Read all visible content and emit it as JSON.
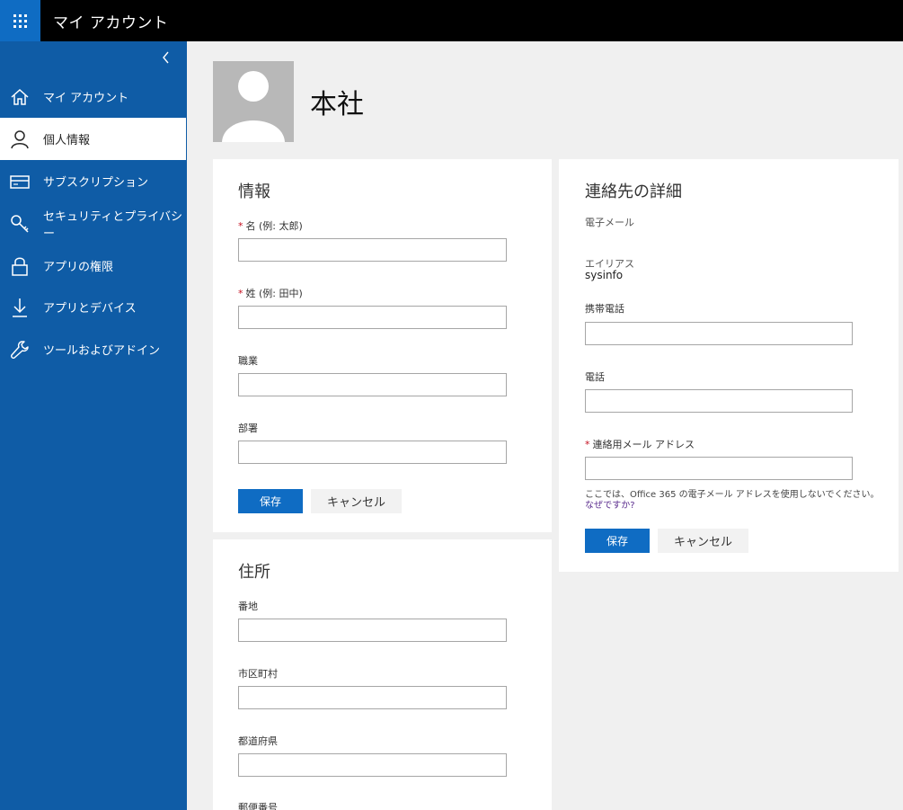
{
  "app": {
    "title": "マイ アカウント"
  },
  "sidebar": {
    "items": [
      {
        "label": "マイ アカウント",
        "icon": "home-icon",
        "active": false
      },
      {
        "label": "個人情報",
        "icon": "person-icon",
        "active": true
      },
      {
        "label": "サブスクリプション",
        "icon": "card-icon",
        "active": false
      },
      {
        "label": "セキュリティとプライバシー",
        "icon": "key-icon",
        "active": false
      },
      {
        "label": "アプリの権限",
        "icon": "lock-icon",
        "active": false
      },
      {
        "label": "アプリとデバイス",
        "icon": "download-icon",
        "active": false
      },
      {
        "label": "ツールおよびアドイン",
        "icon": "wrench-icon",
        "active": false
      }
    ]
  },
  "profile": {
    "name": "本社"
  },
  "info_card": {
    "title": "情報",
    "fields": [
      {
        "label": "名 (例: 太郎)",
        "required": true,
        "value": ""
      },
      {
        "label": "姓 (例: 田中)",
        "required": true,
        "value": ""
      },
      {
        "label": "職業",
        "required": false,
        "value": ""
      },
      {
        "label": "部署",
        "required": false,
        "value": ""
      }
    ],
    "save_label": "保存",
    "cancel_label": "キャンセル"
  },
  "address_card": {
    "title": "住所",
    "fields": [
      {
        "label": "番地",
        "value": ""
      },
      {
        "label": "市区町村",
        "value": ""
      },
      {
        "label": "都道府県",
        "value": ""
      },
      {
        "label": "郵便番号",
        "value": ""
      }
    ]
  },
  "contact_card": {
    "title": "連絡先の詳細",
    "email_label": "電子メール",
    "email_value": "",
    "alias_label": "エイリアス",
    "alias_value": "sysinfo",
    "mobile_label": "携帯電話",
    "phone_label": "電話",
    "contact_email_label": "連絡用メール アドレス",
    "contact_email_required": true,
    "hint": "ここでは、Office 365 の電子メール アドレスを使用しないでください。",
    "why_link": "なぜですか?",
    "save_label": "保存",
    "cancel_label": "キャンセル"
  },
  "colors": {
    "topbar": "#000000",
    "waffle": "#0f6cc3",
    "sidebar": "#0f5ca6",
    "primary_button": "#0f6cc3",
    "required": "#c50f1f"
  }
}
